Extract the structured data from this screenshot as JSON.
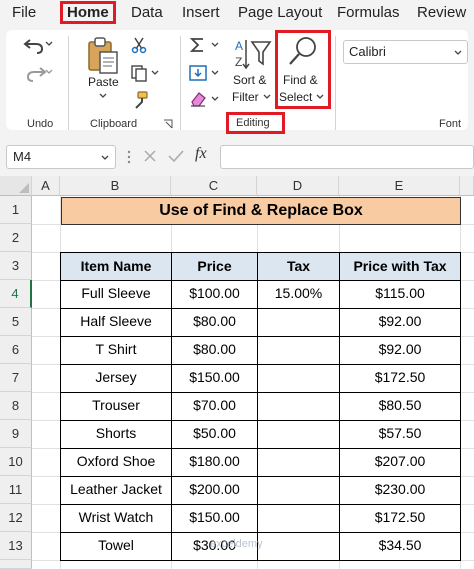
{
  "menu": {
    "tabs": [
      "File",
      "Home",
      "Data",
      "Insert",
      "Page Layout",
      "Formulas",
      "Review"
    ],
    "active_tab": "Home"
  },
  "ribbon": {
    "undo_group_label": "Undo",
    "clipboard_group_label": "Clipboard",
    "paste_label": "Paste",
    "sort_filter_label_1": "Sort &",
    "sort_filter_label_2": "Filter",
    "find_select_label_1": "Find &",
    "find_select_label_2": "Select",
    "editing_group_label": "Editing",
    "font_name": "Calibri",
    "font_group_label": "Font"
  },
  "formula_bar": {
    "name_box": "M4",
    "fx_label": "fx",
    "formula": ""
  },
  "grid": {
    "columns": [
      "A",
      "B",
      "C",
      "D",
      "E"
    ],
    "rows": [
      "1",
      "2",
      "3",
      "4",
      "5",
      "6",
      "7",
      "8",
      "9",
      "10",
      "11",
      "12",
      "13"
    ],
    "selected_row": "4"
  },
  "sheet": {
    "title": "Use of Find & Replace Box",
    "headers": [
      "Item Name",
      "Price",
      "Tax",
      "Price with Tax"
    ],
    "rows": [
      [
        "Full Sleeve",
        "$100.00",
        "15.00%",
        "$115.00"
      ],
      [
        "Half Sleeve",
        "$80.00",
        "",
        "$92.00"
      ],
      [
        "T Shirt",
        "$80.00",
        "",
        "$92.00"
      ],
      [
        "Jersey",
        "$150.00",
        "",
        "$172.50"
      ],
      [
        "Trouser",
        "$70.00",
        "",
        "$80.50"
      ],
      [
        "Shorts",
        "$50.00",
        "",
        "$57.50"
      ],
      [
        "Oxford Shoe",
        "$180.00",
        "",
        "$207.00"
      ],
      [
        "Leather Jacket",
        "$200.00",
        "",
        "$230.00"
      ],
      [
        "Wrist Watch",
        "$150.00",
        "",
        "$172.50"
      ],
      [
        "Towel",
        "$30.00",
        "",
        "$34.50"
      ]
    ]
  },
  "watermark": "exceldemy",
  "colors": {
    "accent_red": "#e01b24",
    "title_fill": "#f8cba3",
    "header_fill": "#dce6f1",
    "excel_green": "#217346"
  }
}
